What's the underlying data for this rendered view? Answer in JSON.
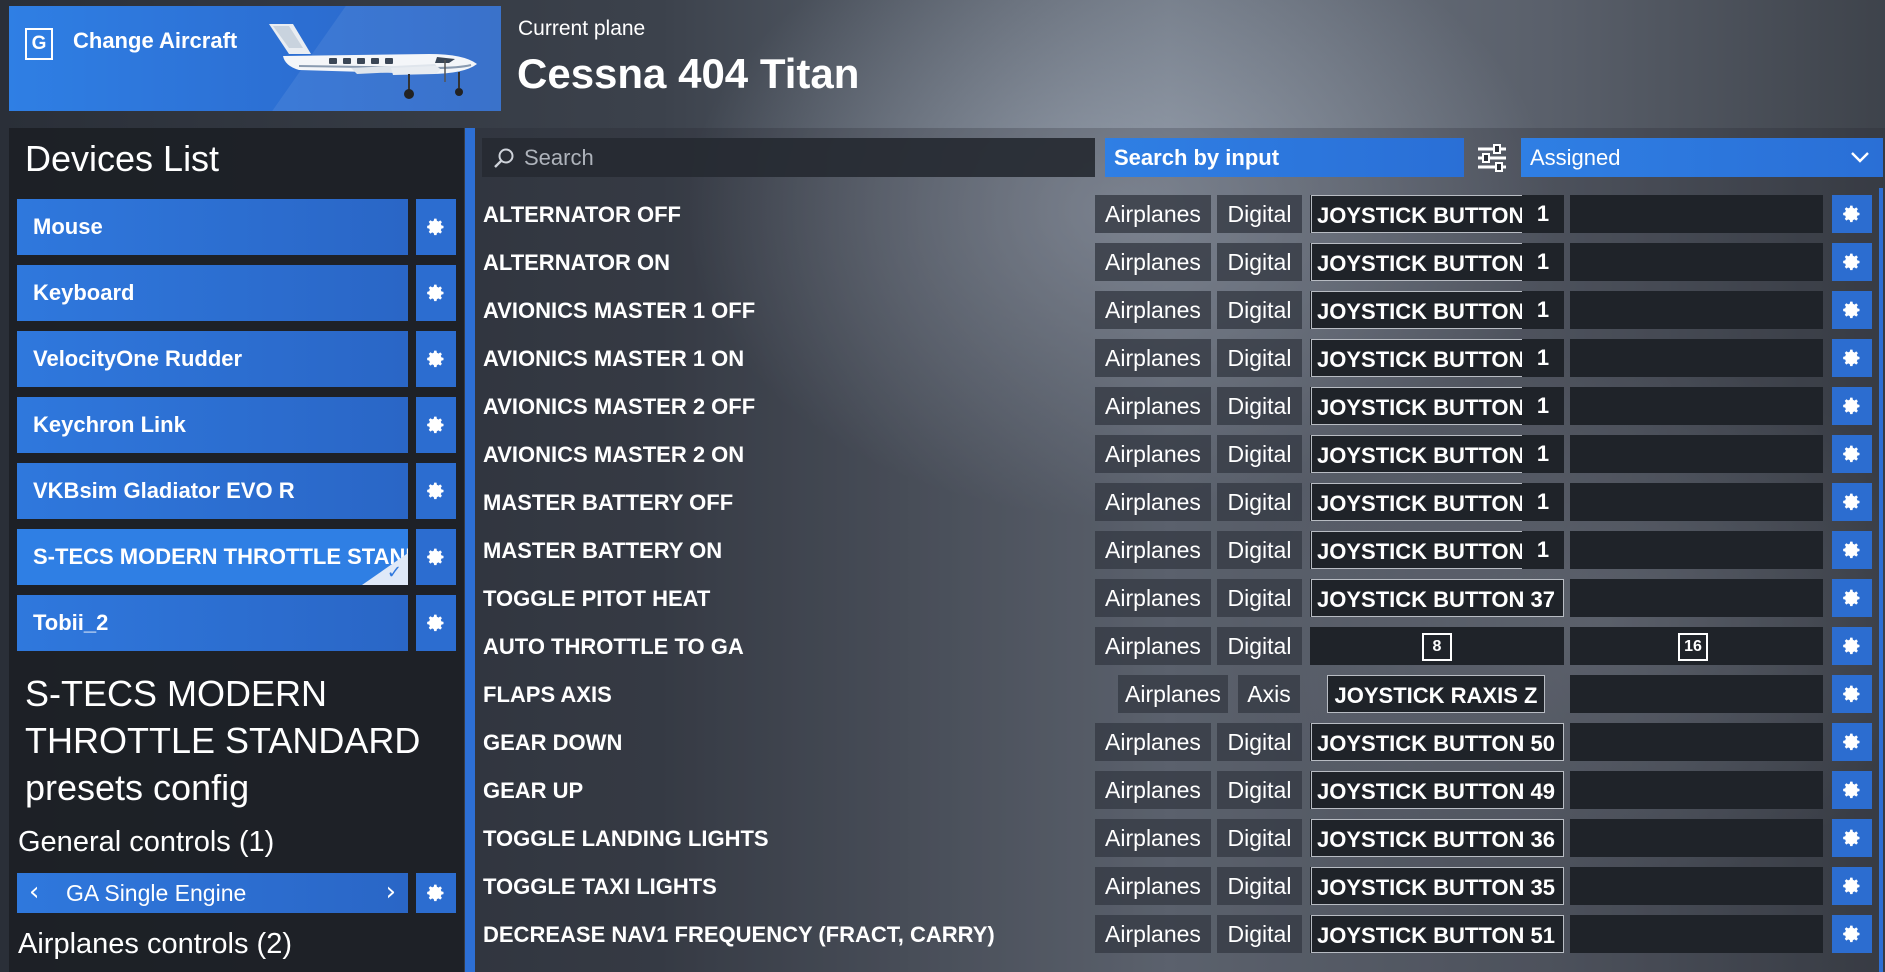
{
  "header": {
    "change_key": "G",
    "change_label": "Change Aircraft",
    "current_label": "Current plane",
    "plane_name": "Cessna 404 Titan"
  },
  "devices": {
    "title": "Devices List",
    "items": [
      {
        "label": "Mouse"
      },
      {
        "label": "Keyboard"
      },
      {
        "label": "VelocityOne Rudder"
      },
      {
        "label": "Keychron Link"
      },
      {
        "label": "VKBsim Gladiator EVO R"
      },
      {
        "label": "S-TECS MODERN THROTTLE STANDARD",
        "selected": true
      },
      {
        "label": "Tobii_2"
      }
    ]
  },
  "presets": {
    "title": "S-TECS MODERN THROTTLE STANDARD presets config",
    "general_label": "General controls (1)",
    "general_value": "GA Single Engine",
    "airplanes_label": "Airplanes controls (2)"
  },
  "toolbar": {
    "search_placeholder": "Search",
    "search_by_input": "Search by input",
    "filter_value": "Assigned"
  },
  "bindings": [
    {
      "action": "ALTERNATOR OFF",
      "category": "Airplanes",
      "type": "Digital",
      "input1": "JOYSTICK BUTTON 1",
      "num": "1",
      "input2": ""
    },
    {
      "action": "ALTERNATOR ON",
      "category": "Airplanes",
      "type": "Digital",
      "input1": "JOYSTICK BUTTON 1",
      "num": "1",
      "input2": ""
    },
    {
      "action": "AVIONICS MASTER 1 OFF",
      "category": "Airplanes",
      "type": "Digital",
      "input1": "JOYSTICK BUTTON 1",
      "num": "1",
      "input2": ""
    },
    {
      "action": "AVIONICS MASTER 1 ON",
      "category": "Airplanes",
      "type": "Digital",
      "input1": "JOYSTICK BUTTON 1",
      "num": "1",
      "input2": ""
    },
    {
      "action": "AVIONICS MASTER 2 OFF",
      "category": "Airplanes",
      "type": "Digital",
      "input1": "JOYSTICK BUTTON 1",
      "num": "1",
      "input2": ""
    },
    {
      "action": "AVIONICS MASTER 2 ON",
      "category": "Airplanes",
      "type": "Digital",
      "input1": "JOYSTICK BUTTON 1",
      "num": "1",
      "input2": ""
    },
    {
      "action": "MASTER BATTERY OFF",
      "category": "Airplanes",
      "type": "Digital",
      "input1": "JOYSTICK BUTTON 1",
      "num": "1",
      "input2": ""
    },
    {
      "action": "MASTER BATTERY ON",
      "category": "Airplanes",
      "type": "Digital",
      "input1": "JOYSTICK BUTTON 1",
      "num": "1",
      "input2": ""
    },
    {
      "action": "TOGGLE PITOT HEAT",
      "category": "Airplanes",
      "type": "Digital",
      "input1": "JOYSTICK BUTTON 37",
      "input2": ""
    },
    {
      "action": "AUTO THROTTLE TO GA",
      "category": "Airplanes",
      "type": "Digital",
      "key1": "8",
      "key2": "16"
    },
    {
      "action": "FLAPS AXIS",
      "category": "Airplanes",
      "type": "Axis",
      "input1": "JOYSTICK RAXIS Z",
      "input2": ""
    },
    {
      "action": "GEAR DOWN",
      "category": "Airplanes",
      "type": "Digital",
      "input1": "JOYSTICK BUTTON 50",
      "input2": ""
    },
    {
      "action": "GEAR UP",
      "category": "Airplanes",
      "type": "Digital",
      "input1": "JOYSTICK BUTTON 49",
      "input2": ""
    },
    {
      "action": "TOGGLE LANDING LIGHTS",
      "category": "Airplanes",
      "type": "Digital",
      "input1": "JOYSTICK BUTTON 36",
      "input2": ""
    },
    {
      "action": "TOGGLE TAXI LIGHTS",
      "category": "Airplanes",
      "type": "Digital",
      "input1": "JOYSTICK BUTTON 35",
      "input2": ""
    },
    {
      "action": "DECREASE NAV1 FREQUENCY (FRACT, CARRY)",
      "category": "Airplanes",
      "type": "Digital",
      "input1": "JOYSTICK BUTTON 51",
      "input2": ""
    }
  ],
  "colors": {
    "accent": "#2f7fe4",
    "panel": "#1c1f25",
    "slot": "#1f2329"
  }
}
